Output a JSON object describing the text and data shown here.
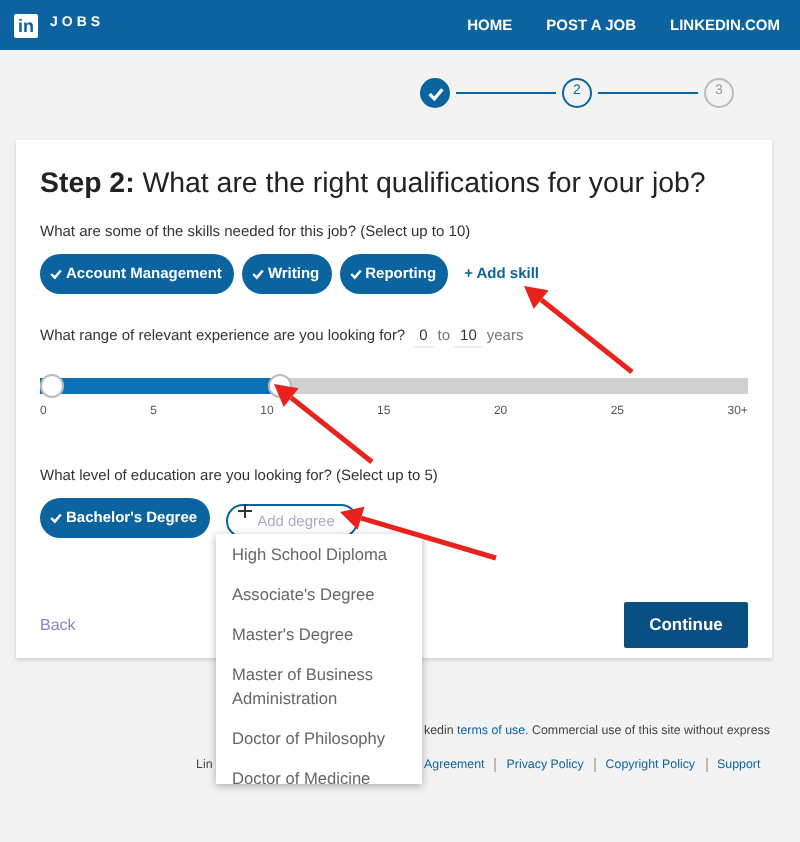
{
  "navbar": {
    "brand_logo": "in",
    "brand": "JOBS",
    "links": [
      "HOME",
      "POST A JOB",
      "LINKEDIN.COM"
    ]
  },
  "steps": [
    {
      "completed": true,
      "selected": false
    },
    {
      "label": "2",
      "completed": false,
      "selected": true
    },
    {
      "label": "3",
      "completed": false,
      "selected": false
    }
  ],
  "card": {
    "title_bold": "Step 2:",
    "title": "What are the right qualifications for your job?",
    "skills": {
      "question": "What are some of the skills needed for this job? (Select up to 10)",
      "chips": [
        "Account Management",
        "Writing",
        "Reporting"
      ],
      "add": "+ Add skill"
    },
    "experience": {
      "question": "What range of relevant experience are you looking for?",
      "from": "0",
      "to_label": "to",
      "to": "10",
      "unit": "years",
      "slider": {
        "level": 0.333
      },
      "ticks": [
        "0",
        "5",
        "10",
        "15",
        "20",
        "25",
        "30+"
      ]
    },
    "education": {
      "question": "What level of education are you looking for? (Select up to 5)",
      "chips": [
        "Bachelor's Degree"
      ],
      "add_placeholder": "Add degree",
      "options": [
        "High School Diploma",
        "Associate's Degree",
        "Master's Degree",
        "Master of Business Administration",
        "Doctor of Philosophy",
        "Doctor of Medicine"
      ]
    },
    "back": "Back",
    "continue": "Continue"
  },
  "footer": {
    "line_1_right": "kedin",
    "terms_link": "terms of use.",
    "line_1_tail": "Commercial use of this site without express",
    "line_2_left": "Lin",
    "links": [
      "Agreement",
      "Privacy Policy",
      "Copyright Policy",
      "Support"
    ]
  },
  "annotations": [
    {
      "kind": "arrow"
    },
    {
      "kind": "arrow"
    },
    {
      "kind": "arrow"
    }
  ]
}
